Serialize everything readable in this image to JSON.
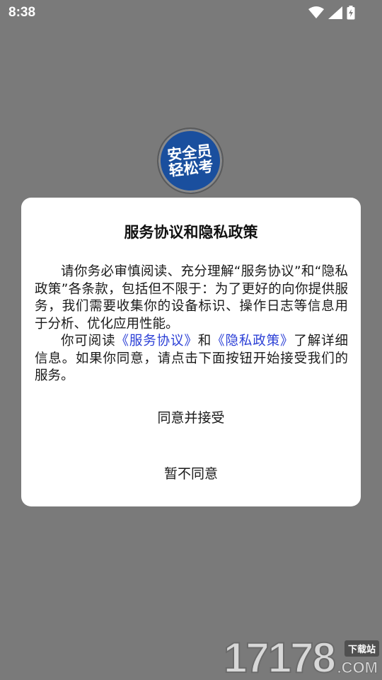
{
  "status_bar": {
    "time": "8:38",
    "icons": [
      "wifi-icon",
      "signal-icon",
      "battery-charging-icon"
    ]
  },
  "app_logo": {
    "line1": "安全员",
    "line2": "轻松考",
    "color": "#1a4f9e"
  },
  "dialog": {
    "title": "服务协议和隐私政策",
    "paragraph1": "请你务必审慎阅读、充分理解“服务协议”和“隐私政策”各条款，包括但不限于：为了更好的向你提供服务，我们需要收集你的设备标识、操作日志等信息用于分析、优化应用性能。",
    "paragraph2_prefix": "你可阅读",
    "link_service": "《服务协议》",
    "paragraph2_and": "和",
    "link_privacy": "《隐私政策》",
    "paragraph2_suffix": "了解详细信息。如果你同意，请点击下面按钮开始接受我们的服务。",
    "accept_label": "同意并接受",
    "decline_label": "暂不同意",
    "link_color": "#2b3fd6"
  },
  "watermark": {
    "digits": "17178",
    "badge": "下载站",
    "domain": ".COM"
  }
}
